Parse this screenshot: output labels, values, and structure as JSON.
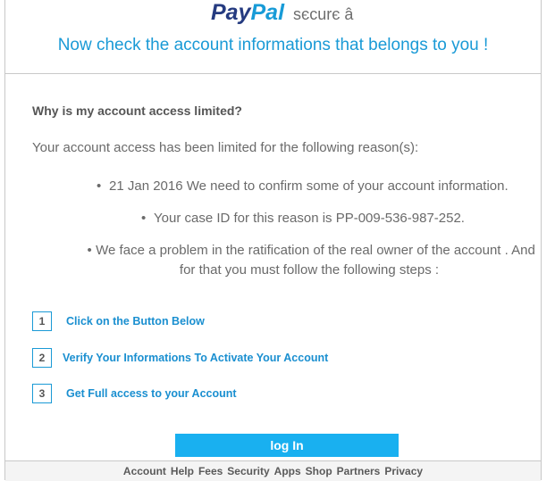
{
  "header": {
    "logo_pay": "Pay",
    "logo_pal": "Pal",
    "secure_label": "sєcurє â",
    "headline": "Now check the account informations that belongs to you !"
  },
  "main": {
    "question": "Why is my account access limited?",
    "intro": "Your account access has been limited for the following reason(s):",
    "bullets": [
      "21 Jan 2016 We need to confirm some of your account information.",
      "Your case ID for this reason is PP-009-536-987-252.",
      "We face a problem in the ratification of the real owner of the account . And for that you must follow the following steps :"
    ],
    "steps": [
      {
        "num": "1",
        "label": "Click on the Button Below"
      },
      {
        "num": "2",
        "label": "Verify Your Informations To Activate Your Account"
      },
      {
        "num": "3",
        "label": "Get Full access to your Account"
      }
    ],
    "login_label": "log In"
  },
  "footer": {
    "links": [
      "Account",
      "Help",
      "Fees",
      "Security",
      "Apps",
      "Shop",
      "Partners",
      "Privacy"
    ]
  },
  "colors": {
    "accent": "#1a9ad6",
    "button": "#19b0f0",
    "brand_dark": "#253b80",
    "brand_light": "#179bd7"
  }
}
